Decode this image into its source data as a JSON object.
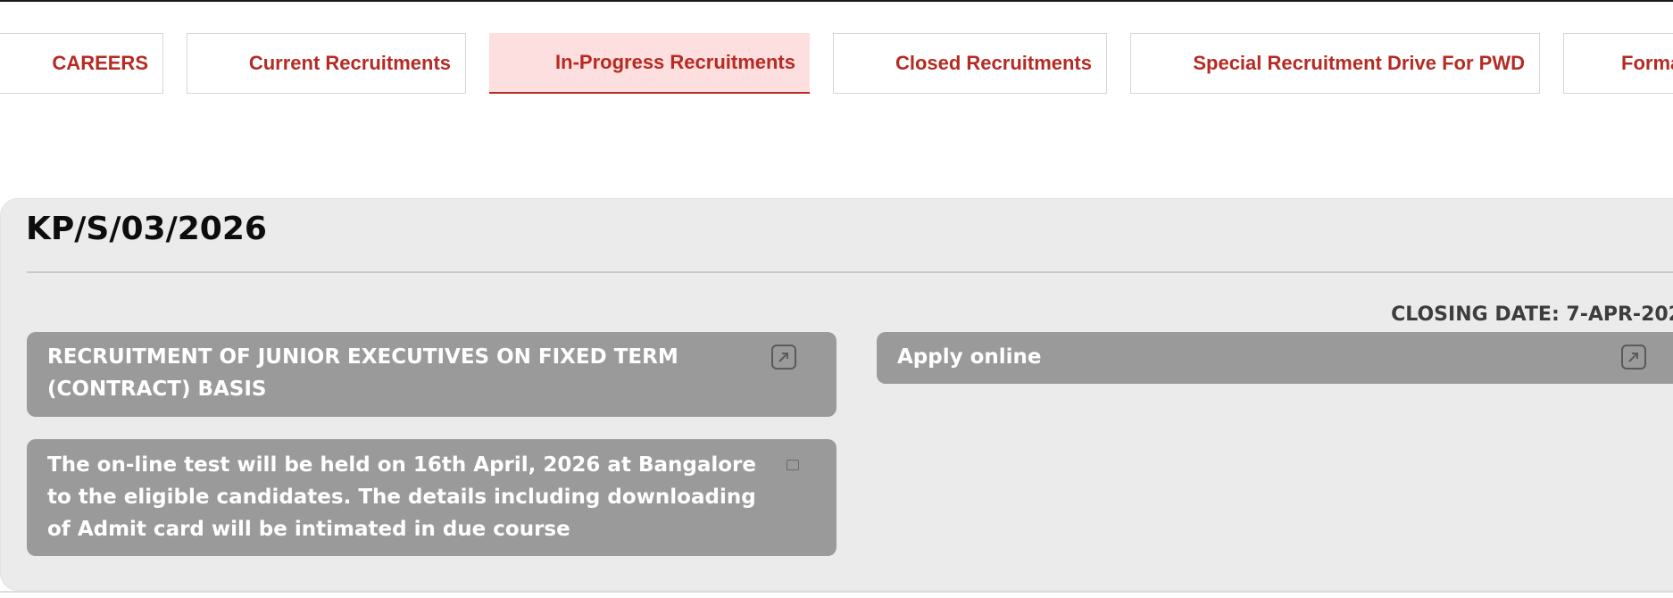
{
  "tabs": [
    {
      "label": "CAREERS",
      "active": false
    },
    {
      "label": "Current Recruitments",
      "active": false
    },
    {
      "label": "In-Progress Recruitments",
      "active": true
    },
    {
      "label": "Closed Recruitments",
      "active": false
    },
    {
      "label": "Special Recruitment Drive For PWD",
      "active": false
    },
    {
      "label": "Forma",
      "active": false
    }
  ],
  "recruitment": {
    "code": "KP/S/03/2026",
    "closing_date": "CLOSING DATE: 7-APR-202",
    "title_item": "RECRUITMENT OF JUNIOR EXECUTIVES ON FIXED TERM (CONTRACT) BASIS",
    "notice_item": "The on-line test will be held on 16th April, 2026 at Bangalore to the eligible candidates. The details including downloading of Admit card will be intimated in due course",
    "apply_item": "Apply online"
  },
  "icons": {
    "external_link": "external-link-icon",
    "document": "document-icon"
  },
  "colors": {
    "accent": "#b52a22",
    "active_tab_bg": "#fddfdf",
    "pill_bg": "#9b9a9a",
    "card_bg": "#ebebeb"
  }
}
